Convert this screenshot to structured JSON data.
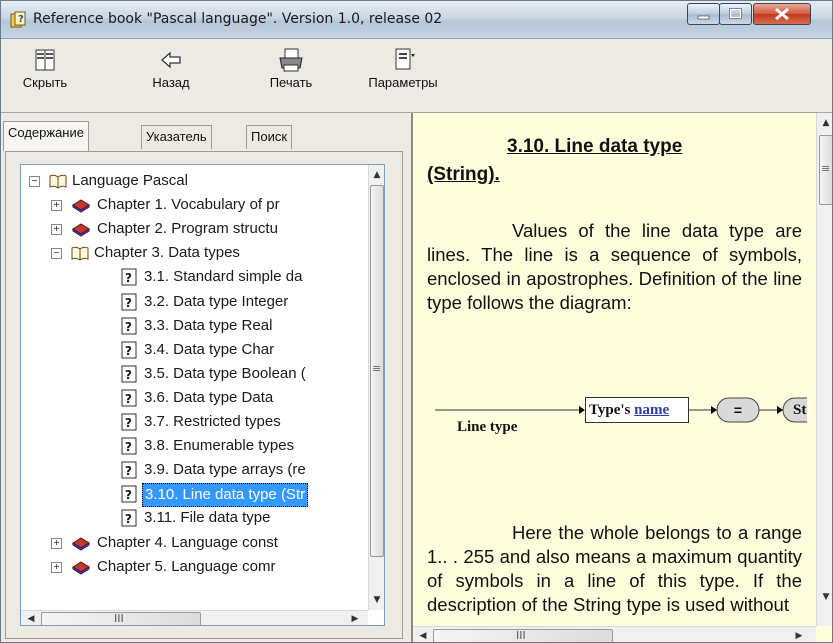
{
  "window": {
    "title": "Reference book \"Pascal language\". Version 1.0, release 02"
  },
  "toolbar": {
    "buttons": [
      {
        "label": "Скрыть",
        "icon": "hide-icon"
      },
      {
        "label": "Назад",
        "icon": "back-arrow-icon"
      },
      {
        "label": "Печать",
        "icon": "printer-icon"
      },
      {
        "label": "Параметры",
        "icon": "options-icon"
      }
    ]
  },
  "tabs": [
    {
      "label": "Содержание",
      "active": true
    },
    {
      "label": "Указатель",
      "active": false
    },
    {
      "label": "Поиск",
      "active": false
    }
  ],
  "tree": {
    "items": [
      {
        "label": "Language Pascal",
        "icon": "open-book-icon",
        "expander": "−",
        "level": 0
      },
      {
        "label": "Chapter 1. Vocabulary of pr",
        "icon": "closed-book-icon",
        "expander": "+",
        "level": 1
      },
      {
        "label": "Chapter 2. Program structu",
        "icon": "closed-book-icon",
        "expander": "+",
        "level": 1
      },
      {
        "label": "Chapter 3. Data types",
        "icon": "open-book-icon",
        "expander": "−",
        "level": 1
      },
      {
        "label": "3.1. Standard simple da",
        "icon": "help-page-icon",
        "level": 2
      },
      {
        "label": "3.2. Data type Integer",
        "icon": "help-page-icon",
        "level": 2
      },
      {
        "label": "3.3. Data type Real",
        "icon": "help-page-icon",
        "level": 2
      },
      {
        "label": "3.4. Data type Char",
        "icon": "help-page-icon",
        "level": 2
      },
      {
        "label": "3.5. Data type Boolean (",
        "icon": "help-page-icon",
        "level": 2
      },
      {
        "label": "3.6. Data type Data",
        "icon": "help-page-icon",
        "level": 2
      },
      {
        "label": "3.7. Restricted types",
        "icon": "help-page-icon",
        "level": 2
      },
      {
        "label": "3.8. Enumerable types",
        "icon": "help-page-icon",
        "level": 2
      },
      {
        "label": "3.9. Data type arrays (re",
        "icon": "help-page-icon",
        "level": 2
      },
      {
        "label": "3.10. Line data type (Str",
        "icon": "help-page-icon",
        "level": 2,
        "selected": true
      },
      {
        "label": "3.11. File data type",
        "icon": "help-page-icon",
        "level": 2
      },
      {
        "label": "Chapter 4. Language const",
        "icon": "closed-book-icon",
        "expander": "+",
        "level": 1
      },
      {
        "label": "Chapter 5. Language comr",
        "icon": "closed-book-icon",
        "expander": "+",
        "level": 1
      }
    ]
  },
  "article": {
    "title_line1": "3.10. Line data type",
    "title_line2": "(String).",
    "paragraph1": "Values of the line data type are lines. The line is a sequence of symbols, enclosed in apostrophes. Definition of the line type follows the diagram:",
    "diagram": {
      "label": "Line type",
      "box_prefix": "Type's ",
      "box_link": "name",
      "equals": "=",
      "next": "St"
    },
    "paragraph2": "Here the whole belongs to a range 1.. . 255 and also means a maximum quantity of symbols in a line of this type. If the description of the String type is used without"
  },
  "scrollbar": {
    "h_grip": "III",
    "v_grip": "≡"
  },
  "colors": {
    "content_bg": "#fefedc",
    "selection": "#3399ff",
    "close_button": "#c7442a",
    "book_red": "#c0392b",
    "book_purple": "#6b3fa0"
  }
}
